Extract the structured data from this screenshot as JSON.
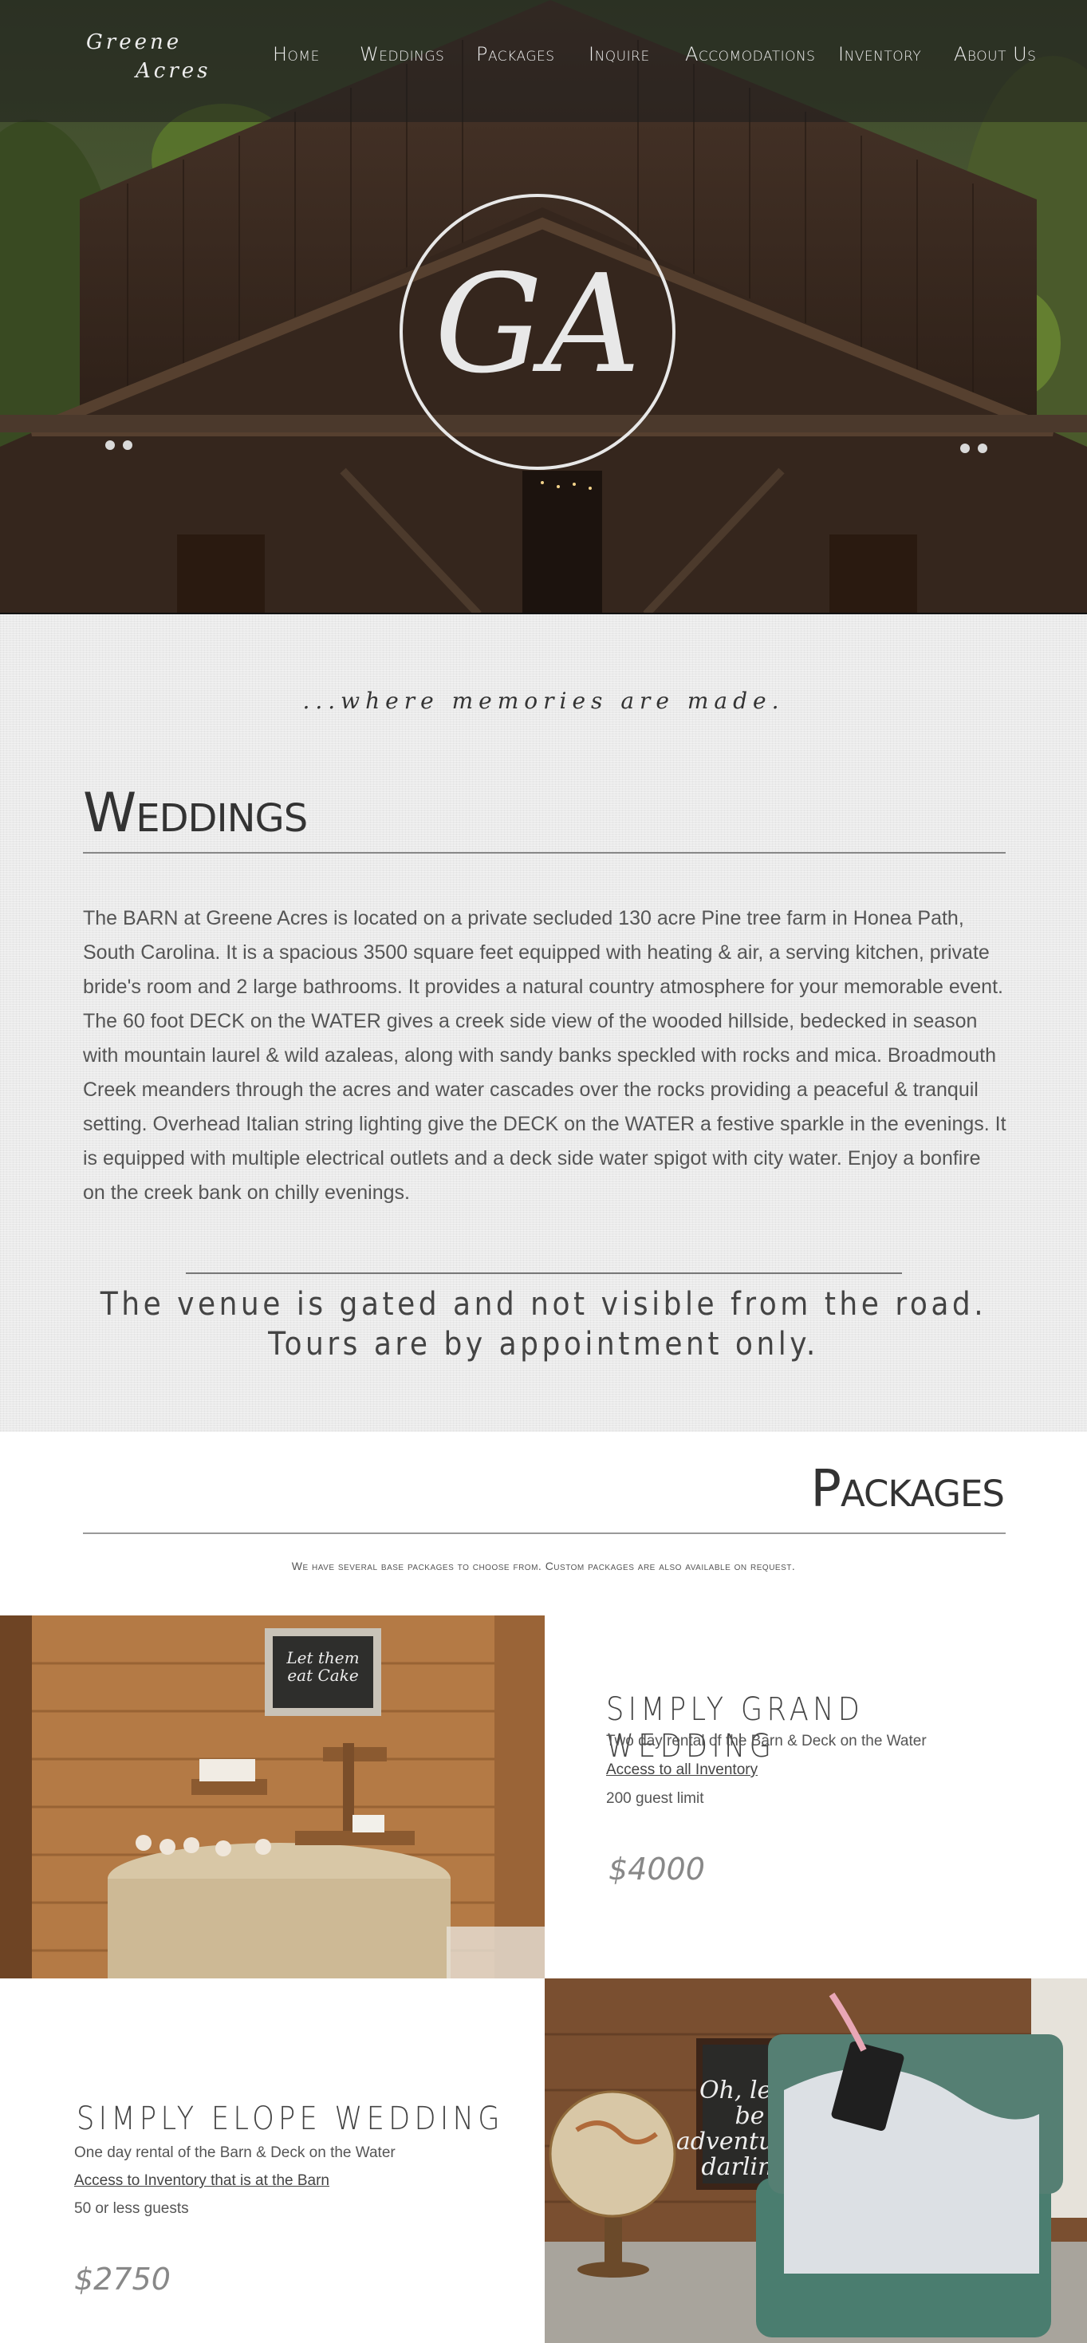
{
  "header": {
    "logo_line1": "Greene",
    "logo_line2": "Acres",
    "nav": [
      "Home",
      "Weddings",
      "Packages",
      "Inquire",
      "Accomodations",
      "Inventory",
      "About Us"
    ]
  },
  "hero": {
    "monogram": "GA"
  },
  "weddings": {
    "tagline": "...where memories are made.",
    "title": "Weddings",
    "body": "The BARN at Greene Acres is located on a private secluded 130 acre Pine tree farm in Honea Path, South Carolina. It is a spacious 3500 square feet equipped with heating & air, a serving kitchen, private bride's room and 2 large bathrooms. It provides a natural country atmosphere for your memorable event. The 60 foot DECK on the WATER gives a creek side view of the wooded hillside, bedecked in season with mountain laurel & wild azaleas, along with sandy banks speckled with rocks and mica. Broadmouth Creek meanders through the acres and water cascades over the rocks providing a peaceful & tranquil setting. Overhead Italian string lighting give the DECK on the WATER a festive sparkle in the evenings.  It is equipped with multiple electrical outlets and a deck side water spigot with city water. Enjoy a bonfire on the creek bank on chilly evenings.",
    "gated_line1": "The venue is gated and not visible from the road.",
    "gated_line2": "Tours are by appointment only."
  },
  "packages": {
    "title": "Packages",
    "subtitle": "We have several base packages to choose from. Custom packages are also available on request.",
    "items": [
      {
        "name": "SIMPLY GRAND WEDDING",
        "line1": "Two day rental of the Barn & Deck on the Water",
        "link": "Access to all Inventory",
        "line3": "200 guest limit",
        "price": "$4000",
        "photo_sign": "Let them eat Cake"
      },
      {
        "name": "SIMPLY ELOPE WEDDING",
        "line1": "One day rental of the Barn & Deck on the Water",
        "link": "Access to Inventory that is at the Barn",
        "line3": "50 or less guests",
        "price": "$2750",
        "photo_sign": "Oh, let's be adventurers darling!",
        "photo_tag": "cards"
      }
    ]
  },
  "colors": {
    "linen_bg": "#ebebeb",
    "barn_wood": "#3b2a20",
    "text_dark": "#333333"
  }
}
